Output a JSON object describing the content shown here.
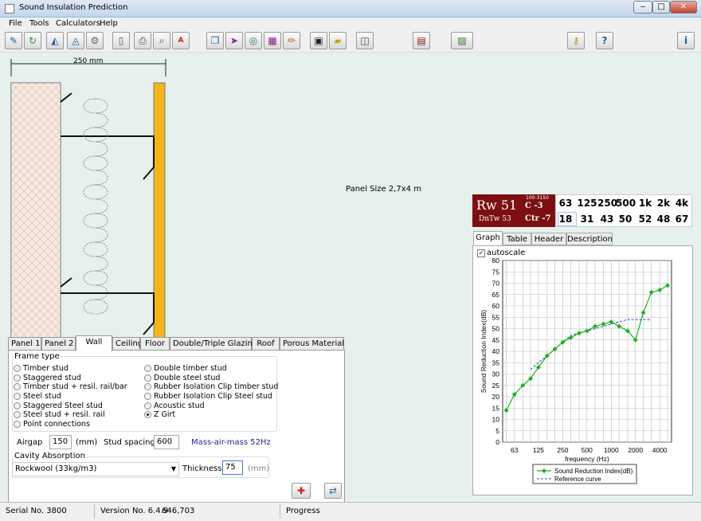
{
  "window": {
    "title": "Sound Insulation Prediction",
    "minimize": "‒",
    "maximize": "□",
    "close": "✕"
  },
  "menu": [
    "File",
    "Tools",
    "Calculators",
    "Help"
  ],
  "toolbar_icons": [
    "pencil-icon",
    "refresh-icon",
    "chart-icon",
    "chart2-icon",
    "gear-icon",
    "new-document-icon",
    "print-icon",
    "print-preview-icon",
    "pdf-icon",
    "copy-icon",
    "export-icon",
    "spiral-icon",
    "graph-icon",
    "edit-icon",
    "save-icon",
    "open-folder-icon",
    "box-icon",
    "calculator-icon",
    "image-icon",
    "key-icon",
    "help-icon",
    "info-icon"
  ],
  "drawing": {
    "dimension": "250 mm",
    "panel_size": "Panel Size 2,7x4 m"
  },
  "tabs": [
    "Panel 1",
    "Panel 2",
    "Wall",
    "Ceiling",
    "Floor",
    "Double/Triple Glazing",
    "Roof",
    "Porous Material"
  ],
  "active_tab": "Wall",
  "frame": {
    "title": "Frame type",
    "options_left": [
      "Timber stud",
      "Staggered stud",
      "Timber stud + resil. rail/bar",
      "Steel stud",
      "Staggered Steel stud",
      "Steel stud + resil. rail",
      "Point connections"
    ],
    "options_right": [
      "Double timber stud",
      "Double steel stud",
      "Rubber Isolation Clip timber stud",
      "Rubber Isolation Clip Steel stud",
      "Acoustic stud",
      "Z Girt"
    ],
    "selected": "Z Girt"
  },
  "airgap": {
    "label": "Airgap",
    "value": "150",
    "unit": "(mm)"
  },
  "stud_spacing": {
    "label": "Stud spacing",
    "value": "600"
  },
  "mass_air_mass": "Mass-air-mass 52Hz",
  "cavity": {
    "title": "Cavity Absorption",
    "material": "Rockwool (33kg/m3)",
    "thickness_label": "Thickness",
    "thickness": "75",
    "unit": "(mm)"
  },
  "rating": {
    "rw": "Rw 51",
    "dntw": "DnTw 53",
    "range": "100-3150",
    "c": "C -3",
    "ctr": "Ctr -7"
  },
  "octave": {
    "freqs": [
      "63",
      "125",
      "250",
      "500",
      "1k",
      "2k",
      "4k"
    ],
    "values": [
      "18",
      "31",
      "43",
      "50",
      "52",
      "48",
      "67"
    ]
  },
  "graph_tabs": [
    "Graph",
    "Table",
    "Header",
    "Description"
  ],
  "active_graph_tab": "Graph",
  "autoscale": "autoscale",
  "chart_data": {
    "type": "line",
    "xlabel": "frequency (Hz)",
    "ylabel": "Sound Reduction Index(dB)",
    "ylim": [
      0,
      80
    ],
    "yticks": [
      0,
      5,
      10,
      15,
      20,
      25,
      30,
      35,
      40,
      45,
      50,
      55,
      60,
      65,
      70,
      75,
      80
    ],
    "xtick_labels": [
      "63",
      "125",
      "250",
      "500",
      "1000",
      "2000",
      "4000"
    ],
    "x_scale": "log (third-octave bands)",
    "grid": true,
    "legend_position": "bottom",
    "series": [
      {
        "name": "Sound Reduction Index(dB)",
        "color": "#19b419",
        "marker": "diamond",
        "x": [
          50,
          63,
          80,
          100,
          125,
          160,
          200,
          250,
          315,
          400,
          500,
          630,
          800,
          1000,
          1250,
          1600,
          2000,
          2500,
          3150,
          4000,
          5000
        ],
        "values": [
          14,
          21,
          25,
          28,
          33,
          38,
          41,
          44,
          46,
          48,
          49,
          51,
          52,
          53,
          51,
          49,
          45,
          57,
          66,
          67,
          69
        ]
      },
      {
        "name": "Reference curve",
        "color": "#3040c8",
        "dash": true,
        "x": [
          100,
          125,
          160,
          200,
          250,
          315,
          400,
          500,
          630,
          800,
          1000,
          1250,
          1600,
          2000,
          2500,
          3150
        ],
        "values": [
          32,
          35,
          38,
          41,
          44,
          47,
          48,
          49,
          50,
          51,
          52,
          53,
          54,
          54,
          54,
          54
        ]
      }
    ]
  },
  "status": {
    "serial": "Serial No. 3800",
    "version": "Version No. 6.4.9",
    "code": "646,703",
    "progress": "Progress"
  }
}
